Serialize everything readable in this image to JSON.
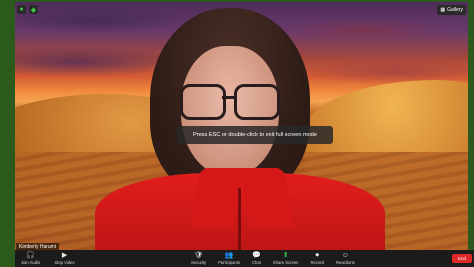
{
  "window": {
    "top_left_icons": [
      {
        "name": "info-icon",
        "glyph": "●"
      },
      {
        "name": "shield-icon",
        "glyph": "◆"
      }
    ],
    "view_button_label": "Gallery",
    "view_icon": "grid-icon"
  },
  "overlay": {
    "esc_message": "Press ESC or double-click to exit full screen mode"
  },
  "participant": {
    "name": "Kimberly Harumi"
  },
  "toolbar": {
    "left": [
      {
        "key": "unmute",
        "label": "Join Audio",
        "icon": "headphones-icon",
        "glyph": "🎧"
      },
      {
        "key": "video",
        "label": "Stop Video",
        "icon": "camera-icon",
        "glyph": "▶"
      }
    ],
    "middle": [
      {
        "key": "security",
        "label": "Security",
        "icon": "shield-icon",
        "glyph": "🛡"
      },
      {
        "key": "participants",
        "label": "Participants",
        "icon": "people-icon",
        "glyph": "👥"
      },
      {
        "key": "chat",
        "label": "Chat",
        "icon": "chat-icon",
        "glyph": "💬"
      },
      {
        "key": "share",
        "label": "Share Screen",
        "icon": "share-screen-icon",
        "glyph": "⬆"
      },
      {
        "key": "record",
        "label": "Record",
        "icon": "record-icon",
        "glyph": "⏺"
      },
      {
        "key": "reactions",
        "label": "Reactions",
        "icon": "smile-icon",
        "glyph": "☺"
      }
    ],
    "end_label": "End"
  },
  "colors": {
    "frame": "#2c5a1c",
    "toolbar_bg": "#1b1b1b",
    "share_green": "#35c04a",
    "end_red": "#e02828"
  }
}
